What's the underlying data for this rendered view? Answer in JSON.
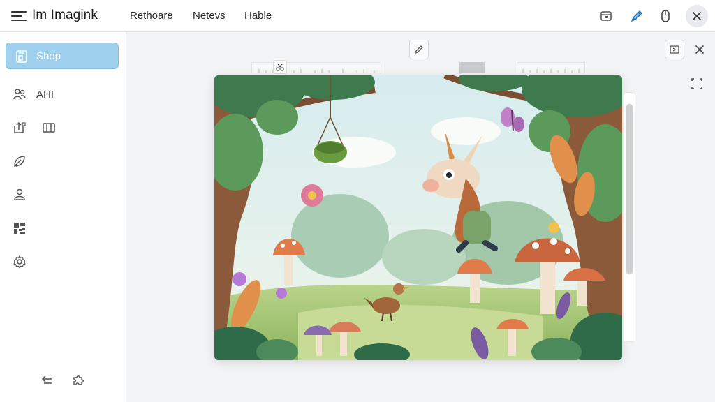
{
  "app": {
    "title": "Im Imagink"
  },
  "nav": {
    "items": [
      "Rethoare",
      "Netevs",
      "Hable"
    ]
  },
  "toolbar_icons": [
    "calendar-icon",
    "pen-icon",
    "mouse-icon",
    "close-icon"
  ],
  "sidebar": {
    "shop_label": "Shop",
    "ahi_label": "AHI",
    "icons": [
      "shop-icon",
      "people-icon",
      "export-icon",
      "book-icon",
      "leaf-icon",
      "user-icon",
      "qr-icon",
      "settings-icon",
      "back-icon",
      "puzzle-icon"
    ]
  },
  "canvas": {
    "tool_icons": [
      "edit-icon",
      "panel-icon",
      "close-icon",
      "crop-icon",
      "cut-icon"
    ],
    "image": "Illustration of a whimsical forest with mushrooms, a deer-like creature and a bird"
  },
  "colors": {
    "accent": "#9fd0ee",
    "topbar": "#ffffff",
    "background": "#f2f3f5"
  }
}
